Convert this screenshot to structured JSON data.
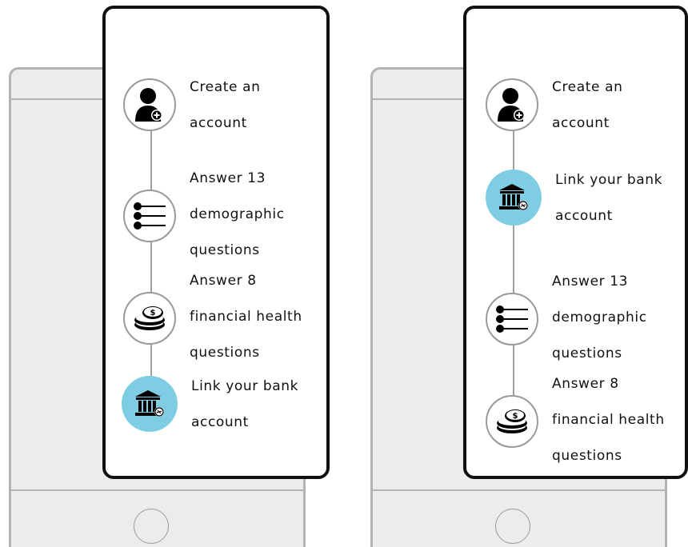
{
  "colors": {
    "active_circle": "#7ecde3",
    "phone_bezel": "#b3b3b3",
    "phone_fill": "#ececec",
    "card_border": "#111111",
    "connector": "#a0a0a0"
  },
  "left_panel": {
    "steps": [
      {
        "icon": "add-user-icon",
        "label_lines": [
          "Create an",
          "account"
        ],
        "active": false
      },
      {
        "icon": "list-icon",
        "label_lines": [
          "Answer 13",
          "demographic",
          "questions"
        ],
        "active": false
      },
      {
        "icon": "coins-icon",
        "label_lines": [
          "Answer 8",
          "financial health",
          "questions"
        ],
        "active": false
      },
      {
        "icon": "bank-icon",
        "label_lines": [
          "Link your bank",
          "account"
        ],
        "active": true
      }
    ]
  },
  "right_panel": {
    "steps": [
      {
        "icon": "add-user-icon",
        "label_lines": [
          "Create an",
          "account"
        ],
        "active": false
      },
      {
        "icon": "bank-icon",
        "label_lines": [
          "Link your bank",
          "account"
        ],
        "active": true
      },
      {
        "icon": "list-icon",
        "label_lines": [
          "Answer 13",
          "demographic",
          "questions"
        ],
        "active": false
      },
      {
        "icon": "coins-icon",
        "label_lines": [
          "Answer 8",
          "financial health",
          "questions"
        ],
        "active": false
      }
    ]
  }
}
